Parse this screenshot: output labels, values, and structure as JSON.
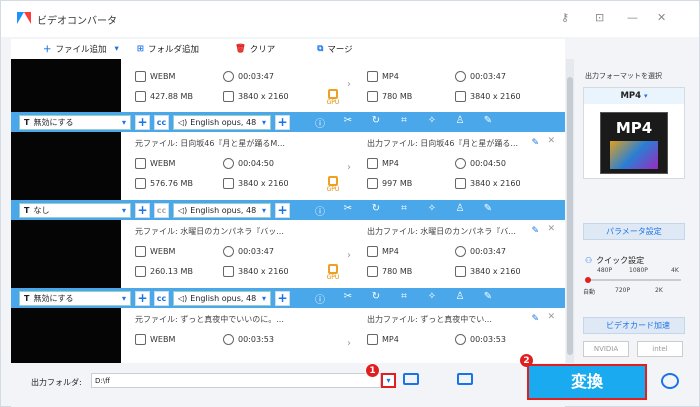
{
  "app": {
    "title": "ビデオコンバータ"
  },
  "toolbar": {
    "add_file": "ファイル追加",
    "add_folder": "フォルダ追加",
    "clear": "クリア",
    "merge": "マージ"
  },
  "rows": [
    {
      "src_name": "",
      "src_fmt": "WEBM",
      "src_dur": "00:03:47",
      "src_size": "427.88 MB",
      "src_res": "3840 x 2160",
      "out_name": "",
      "out_fmt": "MP4",
      "out_dur": "00:03:47",
      "out_size": "780 MB",
      "out_res": "3840 x 2160"
    },
    {
      "src_name": "元ファイル: 日向坂46『月と星が踊るM...",
      "src_fmt": "WEBM",
      "src_dur": "00:04:50",
      "src_size": "576.76 MB",
      "src_res": "3840 x 2160",
      "out_name": "出力ファイル: 日向坂46『月と星が踊る...",
      "out_fmt": "MP4",
      "out_dur": "00:04:50",
      "out_size": "997 MB",
      "out_res": "3840 x 2160"
    },
    {
      "src_name": "元ファイル: 水曜日のカンパネラ『バッ...",
      "src_fmt": "WEBM",
      "src_dur": "00:03:47",
      "src_size": "260.13 MB",
      "src_res": "3840 x 2160",
      "out_name": "出力ファイル: 水曜日のカンパネラ『バ...",
      "out_fmt": "MP4",
      "out_dur": "00:03:47",
      "out_size": "780 MB",
      "out_res": "3840 x 2160"
    },
    {
      "src_name": "元ファイル: ずっと真夜中でいいのに。...",
      "src_fmt": "WEBM",
      "src_dur": "00:03:53",
      "src_size": "",
      "src_res": "",
      "out_name": "出力ファイル: ずっと真夜中でい...",
      "out_fmt": "MP4",
      "out_dur": "00:03:53",
      "out_size": "",
      "out_res": ""
    }
  ],
  "bars": [
    {
      "subtitle": "無効にする",
      "audio": "English opus, 48"
    },
    {
      "subtitle": "なし",
      "audio": "English opus, 48"
    },
    {
      "subtitle": "無効にする",
      "audio": "English opus, 48"
    }
  ],
  "gpu_label": "GPU",
  "footer": {
    "label": "出力フォルダ:",
    "path": "D:\\ff",
    "badge1": "1",
    "badge2": "2",
    "convert": "変換"
  },
  "side": {
    "title": "出力フォーマットを選択",
    "format": "MP4",
    "format_img": "MP4",
    "param": "パラメータ設定",
    "quick": "クイック設定",
    "ticks_top": [
      "480P",
      "1080P",
      "4K"
    ],
    "ticks_bottom": [
      "自動",
      "720P",
      "2K"
    ],
    "gpu_accel": "ビデオカード加速",
    "vendor1": "NVIDIA",
    "vendor2": "intel"
  }
}
